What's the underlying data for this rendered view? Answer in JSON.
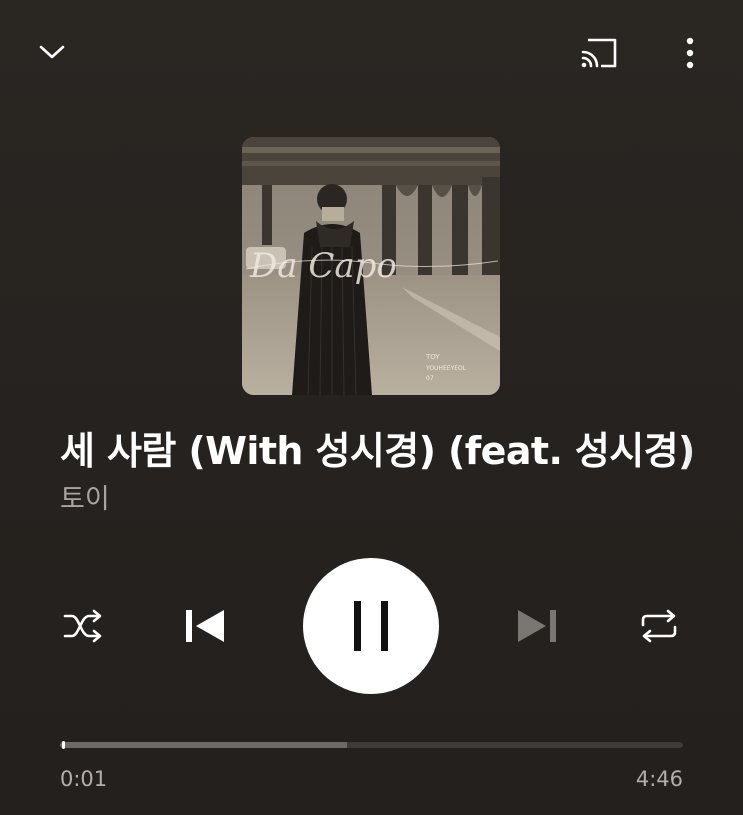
{
  "header": {
    "collapse_icon": "chevron-down-icon",
    "cast_icon": "cast-icon",
    "more_icon": "more-vertical-icon"
  },
  "album_art": {
    "script_text": "Da Capo",
    "label_line1": "TOY",
    "label_line2": "YOUHEEYEOL",
    "label_line3": "07"
  },
  "track": {
    "title": "세 사람 (With 성시경) (feat. 성시경)",
    "artist": "토이"
  },
  "controls": {
    "shuffle_icon": "shuffle-icon",
    "previous_icon": "skip-previous-icon",
    "play_pause_icon": "pause-icon",
    "next_icon": "skip-next-icon",
    "repeat_icon": "repeat-icon"
  },
  "playback": {
    "elapsed": "0:01",
    "duration": "4:46",
    "buffered_fraction": 0.46,
    "played_fraction": 0.004
  },
  "colors": {
    "background": "#26221f",
    "primary_text": "#ffffff",
    "secondary_text": "#a9a49f",
    "disabled_icon": "#7a7672"
  }
}
